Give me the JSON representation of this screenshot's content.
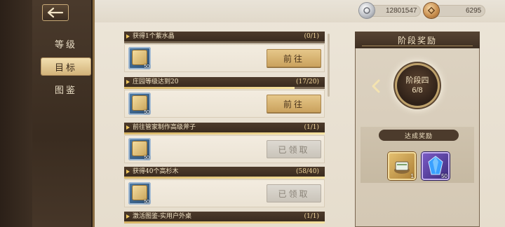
{
  "sidebar": {
    "items": [
      {
        "label": "等级",
        "active": false
      },
      {
        "label": "目标",
        "active": true
      },
      {
        "label": "图鉴",
        "active": false
      }
    ]
  },
  "resources": [
    {
      "icon": "silver-coin-icon",
      "value": "12801547"
    },
    {
      "icon": "bronze-coin-icon",
      "value": "6295"
    }
  ],
  "tasks": [
    {
      "title": "获得1个紫水晶",
      "progress": "(0/1)",
      "fill": 0,
      "reward_count": "50",
      "button": "前往",
      "state": "go"
    },
    {
      "title": "庄园等级达到20",
      "progress": "(17/20)",
      "fill": 0.85,
      "reward_count": "50",
      "button": "前往",
      "state": "go"
    },
    {
      "title": "前往管家制作高级斧子",
      "progress": "(1/1)",
      "fill": 1,
      "reward_count": "50",
      "button": "已领取",
      "state": "claimed"
    },
    {
      "title": "获得40个高杉木",
      "progress": "(58/40)",
      "fill": 1,
      "reward_count": "50",
      "button": "已领取",
      "state": "claimed"
    },
    {
      "title": "激活图鉴-实用户外桌",
      "progress": "(1/1)",
      "fill": 1
    }
  ],
  "stage_panel": {
    "title": "阶段奖励",
    "stage_name": "阶段四",
    "stage_progress": "6/8",
    "reward_label": "达成奖励",
    "rewards": [
      {
        "icon": "gold-chest-icon",
        "count": "1"
      },
      {
        "icon": "blue-crystal-icon",
        "count": "50"
      }
    ]
  },
  "colors": {
    "accent_gold": "#d6b464",
    "sidebar_dark": "#3a2c20",
    "panel_bg": "#ddd3c2"
  }
}
